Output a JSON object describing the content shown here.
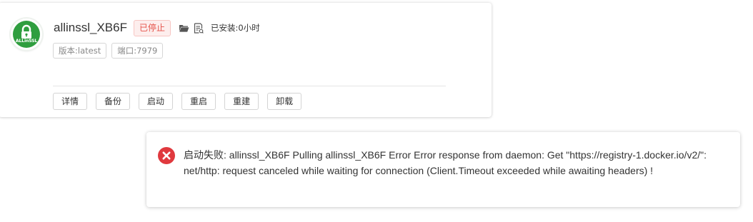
{
  "app_card": {
    "logo": {
      "icon": "lock-icon",
      "text": "ALLinSSL",
      "color": "#2f9e3f"
    },
    "name": "allinssl_XB6F",
    "status": "已停止",
    "folder_icon": "folder-icon",
    "log_icon": "log-file-icon",
    "install_time": "已安装:0小时",
    "tags": {
      "version": "版本:latest",
      "port": "端口:7979"
    },
    "actions": {
      "details": "详情",
      "backup": "备份",
      "start": "启动",
      "restart": "重启",
      "rebuild": "重建",
      "uninstall": "卸载"
    }
  },
  "error_toast": {
    "icon": "error-x-icon",
    "color": "#e0393e",
    "message": "启动失败: allinssl_XB6F Pulling allinssl_XB6F Error Error response from daemon: Get \"https://registry-1.docker.io/v2/\": net/http: request canceled while waiting for connection (Client.Timeout exceeded while awaiting headers) !"
  }
}
